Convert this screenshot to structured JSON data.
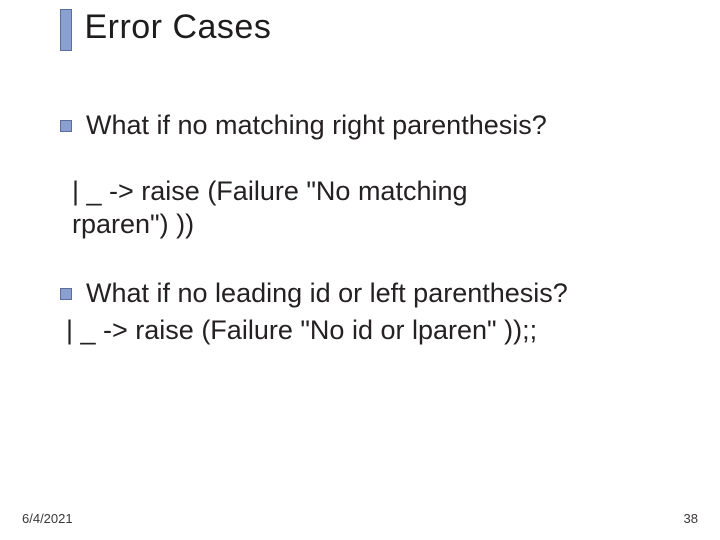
{
  "title": "Error Cases",
  "bullets": [
    {
      "text": "What if no matching right parenthesis?",
      "code_line1": "  | _ -> raise (Failure \"No matching",
      "code_line2": "rparen\") ))"
    },
    {
      "text": "What if no leading id or left parenthesis?",
      "code": " | _ -> raise (Failure \"No id or lparen\" ));;"
    }
  ],
  "footer": {
    "date": "6/4/2021",
    "page": "38"
  }
}
